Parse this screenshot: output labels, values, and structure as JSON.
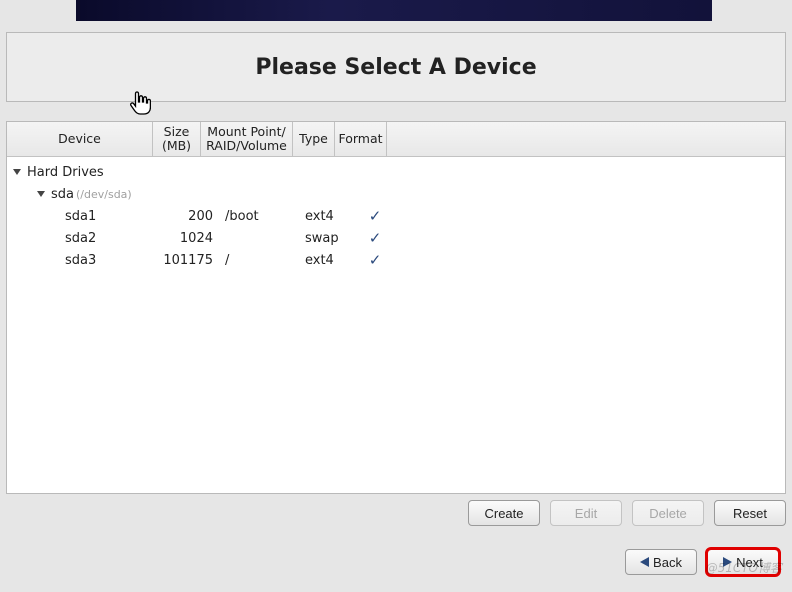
{
  "title": "Please Select A Device",
  "columns": {
    "device": "Device",
    "size": "Size\n(MB)",
    "mount": "Mount Point/\nRAID/Volume",
    "type": "Type",
    "format": "Format"
  },
  "tree": {
    "root_label": "Hard Drives",
    "disk": {
      "name": "sda",
      "path": "(/dev/sda)",
      "partitions": [
        {
          "name": "sda1",
          "size": "200",
          "mount": "/boot",
          "type": "ext4",
          "format": true
        },
        {
          "name": "sda2",
          "size": "1024",
          "mount": "",
          "type": "swap",
          "format": true
        },
        {
          "name": "sda3",
          "size": "101175",
          "mount": "/",
          "type": "ext4",
          "format": true
        }
      ]
    }
  },
  "buttons": {
    "create": "Create",
    "edit": "Edit",
    "delete": "Delete",
    "reset": "Reset",
    "back": "Back",
    "next": "Next"
  },
  "watermark": "@51CTO博客"
}
